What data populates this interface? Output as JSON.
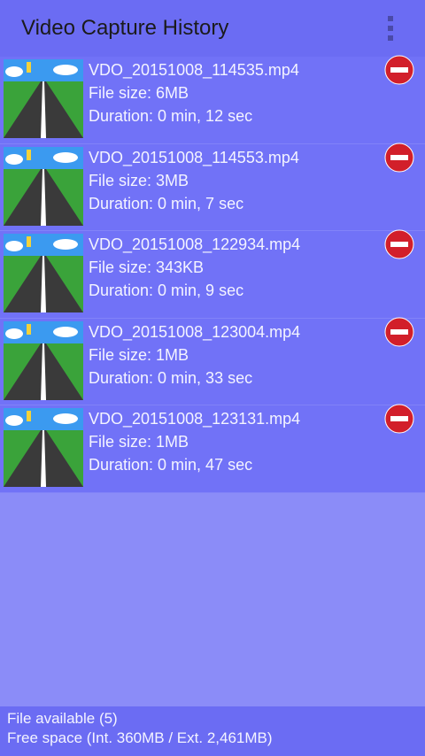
{
  "appbar": {
    "title": "Video Capture History",
    "menu_icon": "overflow-menu-icon"
  },
  "videos": [
    {
      "name": "VDO_20151008_114535.mp4",
      "size": "File size: 6MB",
      "duration": "Duration: 0 min, 12 sec"
    },
    {
      "name": "VDO_20151008_114553.mp4",
      "size": "File size: 3MB",
      "duration": "Duration: 0 min, 7 sec"
    },
    {
      "name": "VDO_20151008_122934.mp4",
      "size": "File size: 343KB",
      "duration": "Duration: 0 min, 9 sec"
    },
    {
      "name": "VDO_20151008_123004.mp4",
      "size": "File size: 1MB",
      "duration": "Duration: 0 min, 33 sec"
    },
    {
      "name": "VDO_20151008_123131.mp4",
      "size": "File size: 1MB",
      "duration": "Duration: 0 min, 47 sec"
    }
  ],
  "footer": {
    "available": "File available (5)",
    "free_space": "Free space (Int. 360MB / Ext. 2,461MB)"
  },
  "colors": {
    "appbar": "#6b6cf3",
    "list": "#7172f7",
    "background": "#8b8cf8",
    "delete": "#d21f2a"
  }
}
